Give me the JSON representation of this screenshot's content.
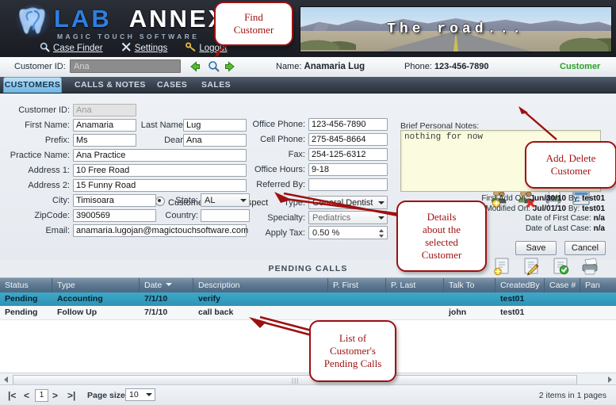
{
  "app": {
    "brand_lab": "LAB",
    "brand_annex": "ANNEX",
    "tagline": "MAGIC TOUCH SOFTWARE",
    "banner_text": "The      road..."
  },
  "nav": {
    "items": [
      {
        "label": "Case Finder",
        "icon": "magnifier-icon"
      },
      {
        "label": "Settings",
        "icon": "tools-icon"
      },
      {
        "label": "Logout",
        "icon": "key-icon"
      }
    ]
  },
  "idbar": {
    "customer_id_label": "Customer ID:",
    "customer_id_value": "Ana",
    "prev_icon": "green-left-arrow-icon",
    "search_icon": "magnifier-icon",
    "next_icon": "green-right-arrow-icon",
    "name_label": "Name:",
    "name_value": "Anamaria Lug",
    "phone_label": "Phone:",
    "phone_value": "123-456-7890",
    "record_type": "Customer"
  },
  "tabs": [
    {
      "label": "CUSTOMERS",
      "active": true
    },
    {
      "label": "CALLS & NOTES",
      "active": false
    },
    {
      "label": "CASES",
      "active": false
    },
    {
      "label": "SALES",
      "active": false
    }
  ],
  "form": {
    "labels": {
      "customer_id": "Customer ID:",
      "first_name": "First Name:",
      "last_name": "Last Name:",
      "prefix": "Prefix:",
      "dear": "Dear:",
      "practice_name": "Practice Name:",
      "address1": "Address 1:",
      "address2": "Address 2:",
      "city": "City:",
      "state": "State:",
      "zipcode": "ZipCode:",
      "country": "Country:",
      "email": "Email:",
      "office_phone": "Office Phone:",
      "cell_phone": "Cell Phone:",
      "fax": "Fax:",
      "office_hours": "Office Hours:",
      "referred_by": "Referred By:",
      "type": "Type:",
      "specialty": "Specialty:",
      "apply_tax": "Apply Tax:"
    },
    "values": {
      "customer_id": "Ana",
      "first_name": "Anamaria",
      "last_name": "Lug",
      "prefix": "Ms",
      "dear": "Ana",
      "practice_name": "Ana Practice",
      "address1": "10 Free Road",
      "address2": "15 Funny Road",
      "city": "Timisoara",
      "state": "AL",
      "zipcode": "3900569",
      "country": "",
      "email": "anamaria.lugojan@magictouchsoftware.com",
      "office_phone": "123-456-7890",
      "cell_phone": "275-845-8664",
      "fax": "254-125-6312",
      "office_hours": "9-18",
      "referred_by": "",
      "type": "General Dentist",
      "specialty": "Pediatrics",
      "apply_tax": "0.50 %"
    },
    "radio": {
      "customer": "Customer",
      "prospect": "Prospect",
      "selected": "Customer"
    },
    "notes_label": "Brief Personal Notes:",
    "notes_value": "nothing for now",
    "meta": {
      "first_add_label": "First Add On:",
      "first_add_value": "Jun/30/10",
      "first_add_by_label": "By:",
      "first_add_by": "test01",
      "last_mod_label": "Last Modified On:",
      "last_mod_value": "Jul/01/10",
      "last_mod_by_label": "By:",
      "last_mod_by": "test01",
      "first_case_label": "Date of First Case:",
      "first_case_value": "n/a",
      "last_case_label": "Date of Last Case:",
      "last_case_value": "n/a"
    },
    "save_label": "Save",
    "cancel_label": "Cancel",
    "toolbar": [
      {
        "name": "add-customer-icon",
        "title": "Add Customer"
      },
      {
        "name": "delete-customer-icon",
        "title": "Delete Customer"
      },
      {
        "name": "print-icon",
        "title": "Print"
      },
      {
        "name": "report-icon",
        "title": "Report"
      }
    ]
  },
  "pending_calls": {
    "title": "PENDING CALLS",
    "toolbar": [
      {
        "name": "add-call-icon"
      },
      {
        "name": "edit-call-icon"
      },
      {
        "name": "complete-call-icon"
      },
      {
        "name": "print-calls-icon"
      }
    ],
    "columns": [
      {
        "label": "Status",
        "sorted": false
      },
      {
        "label": "Type",
        "sorted": false
      },
      {
        "label": "Date",
        "sorted": true
      },
      {
        "label": "Description",
        "sorted": false
      },
      {
        "label": "P. First",
        "sorted": false
      },
      {
        "label": "P. Last",
        "sorted": false
      },
      {
        "label": "Talk To",
        "sorted": false
      },
      {
        "label": "CreatedBy",
        "sorted": false
      },
      {
        "label": "Case #",
        "sorted": false
      },
      {
        "label": "Pan Num",
        "sorted": false
      }
    ],
    "rows": [
      {
        "status": "Pending",
        "type": "Accounting",
        "date": "7/1/10",
        "description": "verify",
        "p_first": "",
        "p_last": "",
        "talk_to": "",
        "created_by": "test01",
        "case_no": "",
        "pan_num": "",
        "selected": true
      },
      {
        "status": "Pending",
        "type": "Follow Up",
        "date": "7/1/10",
        "description": "call back",
        "p_first": "",
        "p_last": "",
        "talk_to": "john",
        "created_by": "test01",
        "case_no": "",
        "pan_num": "",
        "selected": false
      }
    ]
  },
  "pager": {
    "first_icon": "first-page-icon",
    "prev_icon": "prev-page-icon",
    "current_page": "1",
    "next_icon": "next-page-icon",
    "last_icon": "last-page-icon",
    "page_size_label": "Page size:",
    "page_size_value": "10",
    "items_text": "2 items in 1 pages"
  },
  "callouts": [
    {
      "id": "find-customer",
      "text": "Find\nCustomer"
    },
    {
      "id": "add-delete-customer",
      "text": "Add, Delete\nCustomer"
    },
    {
      "id": "details-selected-customer",
      "text": "Details\nabout the\nselected\nCustomer"
    },
    {
      "id": "list-pending-calls",
      "text": "List of\nCustomer's\nPending Calls"
    }
  ],
  "colors": {
    "accent_blue": "#2f7fe0",
    "callout_red": "#9d1111",
    "status_green": "#2aa02a",
    "grid_header": "#5e7891",
    "selected_row": "#2e93b5"
  }
}
